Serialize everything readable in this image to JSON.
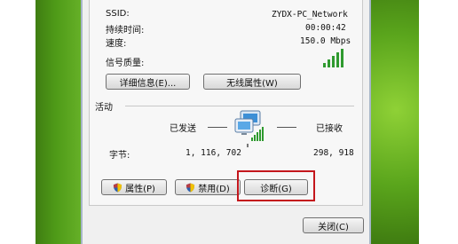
{
  "window": {
    "ssid_label": "SSID:",
    "ssid_value": "ZYDX-PC_Network",
    "duration_label": "持续时间:",
    "duration_value": "00:00:42",
    "speed_label": "速度:",
    "speed_value": "150.0 Mbps",
    "signal_label": "信号质量:",
    "signal_level": 5
  },
  "buttons": {
    "details": "详细信息(E)...",
    "wireless_props": "无线属性(W)",
    "properties": "属性(P)",
    "disable": "禁用(D)",
    "diagnose": "诊断(G)",
    "close": "关闭(C)"
  },
  "activity": {
    "section_label": "活动",
    "sent_label": "已发送",
    "received_label": "已接收",
    "bytes_label": "字节:",
    "bytes_sent": "1, 116, 702",
    "bytes_received": "298, 918"
  },
  "colors": {
    "highlight": "#c4161c",
    "signal_green": "#2f9a2f"
  }
}
